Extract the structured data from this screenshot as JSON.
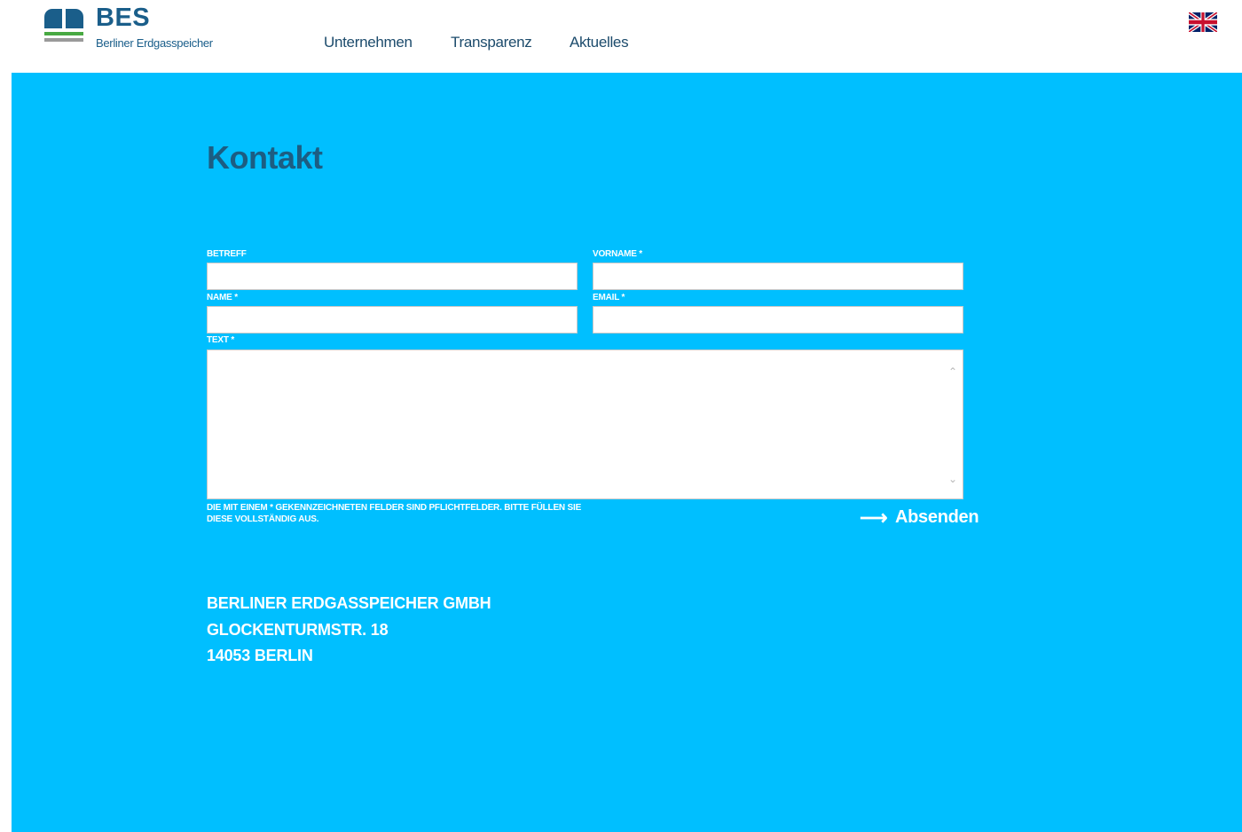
{
  "header": {
    "logo": {
      "title": "BES",
      "subtitle": "Berliner Erdgasspeicher"
    },
    "nav": [
      {
        "label": "Unternehmen"
      },
      {
        "label": "Transparenz"
      },
      {
        "label": "Aktuelles"
      }
    ],
    "language_flag_icon": "uk-flag-icon"
  },
  "contact": {
    "title": "Kontakt",
    "fields": {
      "betreff": {
        "label": "BETREFF",
        "value": ""
      },
      "vorname": {
        "label": "VORNAME *",
        "value": ""
      },
      "name": {
        "label": "NAME *",
        "value": ""
      },
      "email": {
        "label": "EMAIL *",
        "value": ""
      },
      "text": {
        "label": "TEXT *",
        "value": ""
      }
    },
    "required_note": "DIE MIT EINEM * GEKENNZEICHNETEN FELDER SIND PFLICHTFELDER. BITTE FÜLLEN SIE DIESE VOLLSTÄNDIG AUS.",
    "submit": {
      "arrow": "⟶",
      "label": "Absenden"
    }
  },
  "address": {
    "line1": "BERLINER ERDGASSPEICHER GMBH",
    "line2": "GLOCKENTURMSTR. 18",
    "line3": "14053 BERLIN"
  },
  "colors": {
    "brand_blue": "#1a5e8a",
    "panel_blue": "#00bfff",
    "accent_green": "#48a942"
  }
}
